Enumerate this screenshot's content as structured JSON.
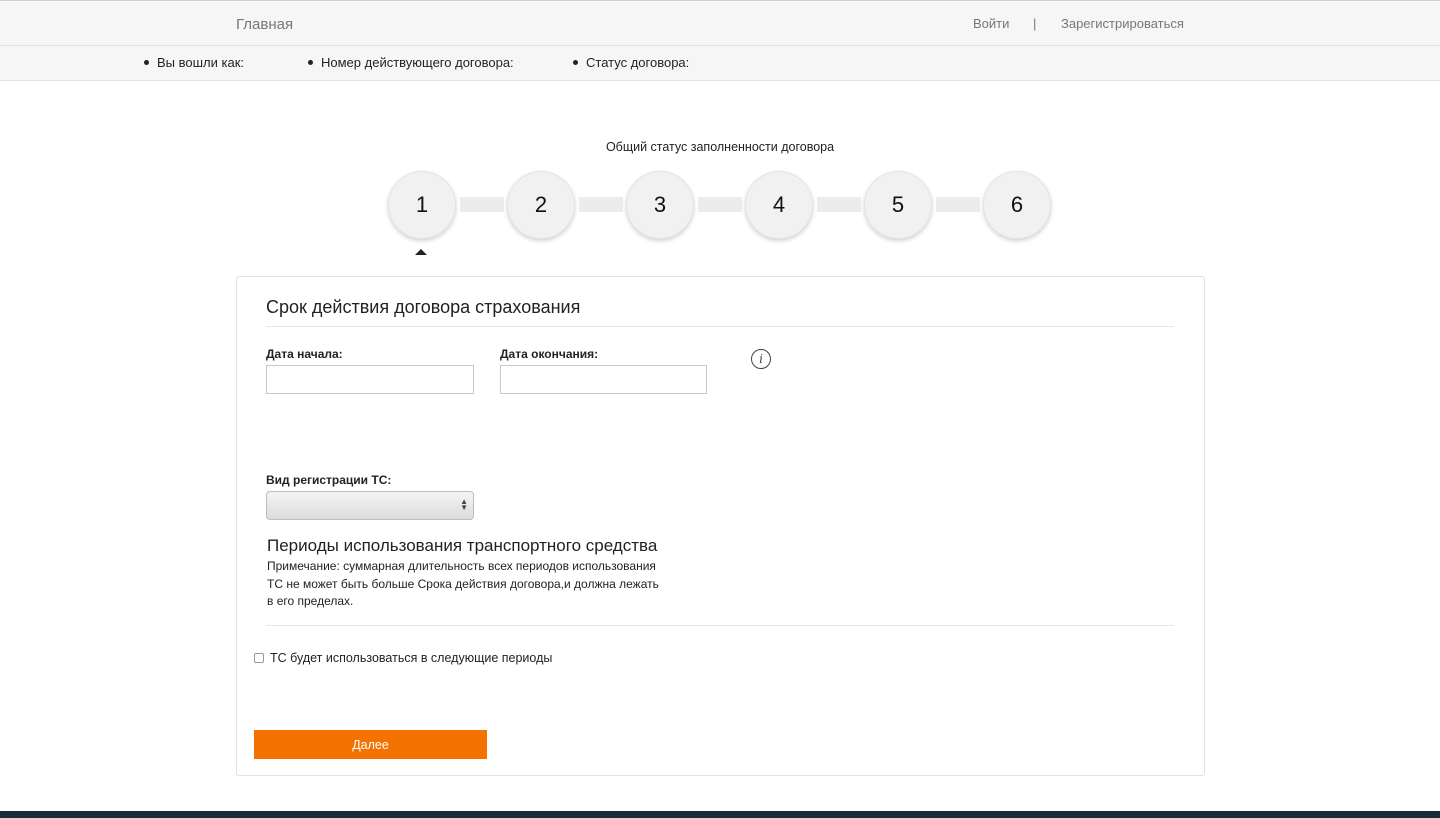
{
  "header": {
    "home_label": "Главная",
    "login_label": "Войти",
    "separator": "|",
    "register_label": "Зарегистрироваться"
  },
  "user_info": {
    "logged_in_as": "Вы вошли как:",
    "contract_number": "Номер действующего договора:",
    "contract_status": "Статус договора:"
  },
  "progress": {
    "title": "Общий статус заполненности договора",
    "steps": [
      "1",
      "2",
      "3",
      "4",
      "5",
      "6"
    ],
    "active_step": 1
  },
  "form": {
    "title": "Срок действия договора страхования",
    "start_date_label": "Дата начала:",
    "start_date_value": "",
    "end_date_label": "Дата окончания:",
    "end_date_value": "",
    "info_icon": "i",
    "registration_label": "Вид регистрации ТС:",
    "registration_value": "",
    "periods_title": "Периоды использования транспортного средства",
    "note_line1": "Примечание: суммарная длительность всех периодов использования",
    "note_line2": "ТС не может быть больше Срока действия договора,и должна лежать",
    "note_line3": "в его пределах.",
    "periods_checkbox_label": "ТС будет использоваться в следующие периоды",
    "periods_checkbox_checked": false,
    "next_button": "Далее"
  },
  "colors": {
    "accent": "#f47300",
    "footer": "#1a2a36"
  }
}
